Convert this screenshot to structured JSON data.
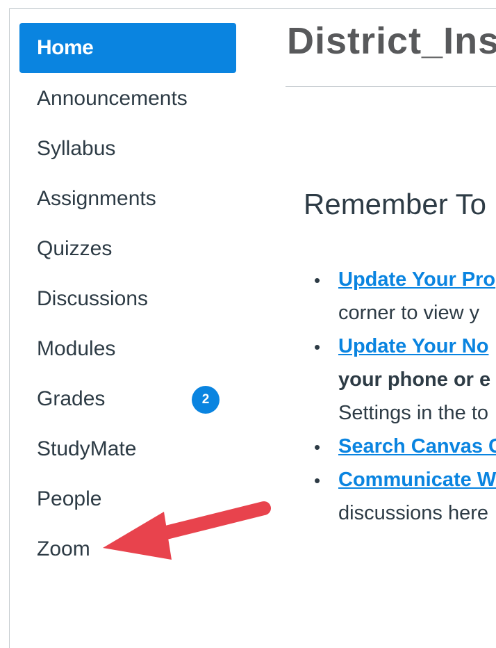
{
  "nav": {
    "home": "Home",
    "items": [
      {
        "label": "Announcements"
      },
      {
        "label": "Syllabus"
      },
      {
        "label": "Assignments"
      },
      {
        "label": "Quizzes"
      },
      {
        "label": "Discussions"
      },
      {
        "label": "Modules"
      },
      {
        "label": "Grades",
        "badge": "2"
      },
      {
        "label": "StudyMate"
      },
      {
        "label": "People"
      },
      {
        "label": "Zoom"
      }
    ]
  },
  "page": {
    "title": "District_Inst",
    "heading": "Remember To",
    "bullets": [
      {
        "link": "Update Your Pro",
        "cont": "corner to view y"
      },
      {
        "link": "Update Your No",
        "cont_bold": "your phone or e",
        "cont2": "Settings in the to"
      },
      {
        "link": "Search Canvas G"
      },
      {
        "link": "Communicate W",
        "cont": "discussions here"
      }
    ]
  },
  "colors": {
    "accent": "#0a84e0",
    "arrow": "#e8434d",
    "text": "#2d3b45"
  }
}
